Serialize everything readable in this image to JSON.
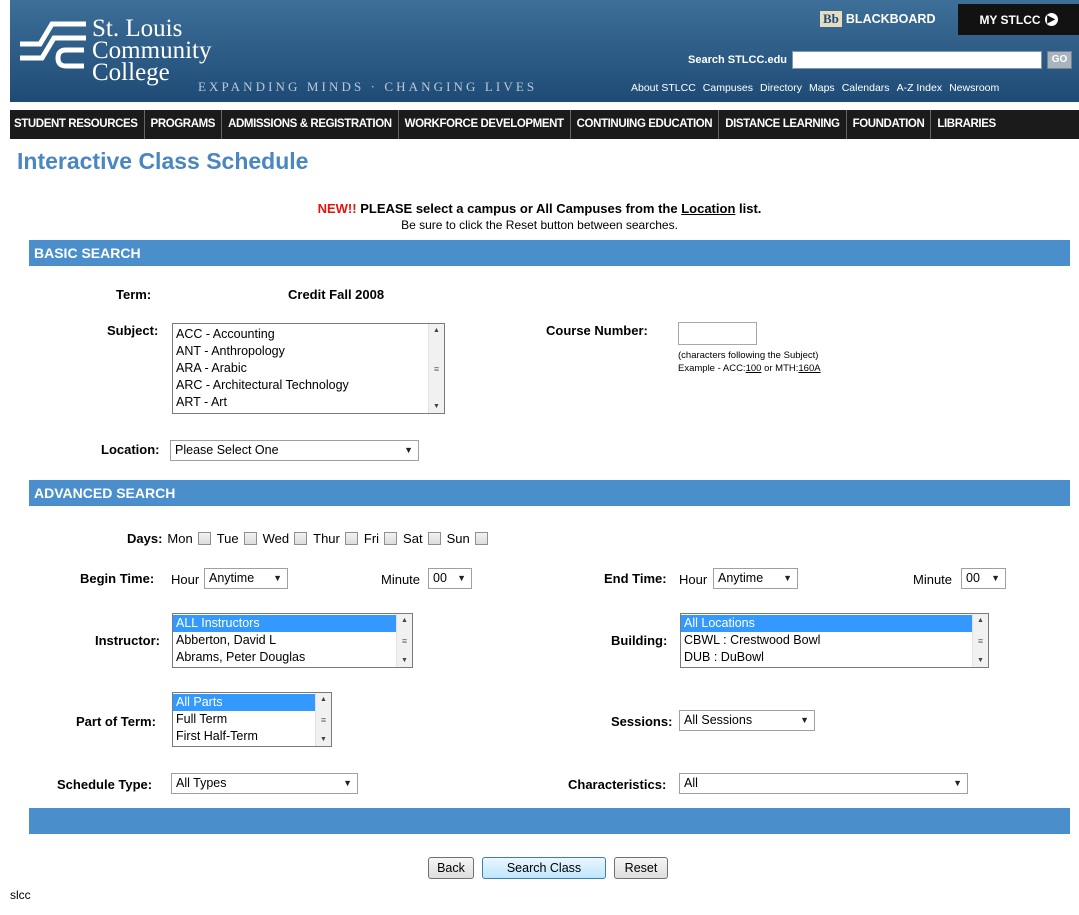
{
  "header": {
    "logo": {
      "line1": "St. Louis",
      "line2": "Community",
      "line3": "College"
    },
    "tagline": "EXPANDING MINDS · CHANGING LIVES",
    "blackboard_badge": "Bb",
    "blackboard_label": "BLACKBOARD",
    "my_stlcc_label": "MY STLCC",
    "search_label": "Search STLCC.edu",
    "search_value": "",
    "go_label": "GO",
    "util_links": [
      "About STLCC",
      "Campuses",
      "Directory",
      "Maps",
      "Calendars",
      "A-Z Index",
      "Newsroom"
    ],
    "brand_color": "#1e4b75"
  },
  "nav": [
    "STUDENT RESOURCES",
    "PROGRAMS",
    "ADMISSIONS & REGISTRATION",
    "WORKFORCE DEVELOPMENT",
    "CONTINUING EDUCATION",
    "DISTANCE LEARNING",
    "FOUNDATION",
    "LIBRARIES"
  ],
  "page": {
    "title": "Interactive Class Schedule",
    "notice_new": "NEW!!",
    "notice_text1": " PLEASE select a campus or All Campuses from the ",
    "notice_link": "Location",
    "notice_text2": " list.",
    "notice_line2": "Be sure to click the Reset button between searches."
  },
  "basic": {
    "header": "BASIC SEARCH",
    "term_label": "Term:",
    "term_value": "Credit Fall 2008",
    "subject_label": "Subject:",
    "subject_options": [
      "ACC - Accounting",
      "ANT - Anthropology",
      "ARA - Arabic",
      "ARC - Architectural Technology",
      "ART - Art"
    ],
    "course_number_label": "Course Number:",
    "course_number_value": "",
    "course_hint": "(characters following the Subject)",
    "example_prefix": "Example - ACC:",
    "example_acc": "100",
    "example_or": " or MTH:",
    "example_mth": "160A",
    "location_label": "Location:",
    "location_value": "Please Select One"
  },
  "advanced": {
    "header": "ADVANCED SEARCH",
    "days_label": "Days:",
    "days": [
      "Mon",
      "Tue",
      "Wed",
      "Thur",
      "Fri",
      "Sat",
      "Sun"
    ],
    "begin_time_label": "Begin Time:",
    "end_time_label": "End Time:",
    "hour_label": "Hour",
    "minute_label": "Minute",
    "begin_hour": "Anytime",
    "begin_minute": "00",
    "end_hour": "Anytime",
    "end_minute": "00",
    "instructor_label": "Instructor:",
    "instructor_options": [
      "ALL Instructors",
      "Abberton, David L",
      "Abrams, Peter Douglas"
    ],
    "building_label": "Building:",
    "building_options": [
      "All Locations",
      "CBWL : Crestwood Bowl",
      "DUB : DuBowl"
    ],
    "part_of_term_label": "Part of Term:",
    "part_of_term_options": [
      "All Parts",
      "Full Term",
      "First Half-Term"
    ],
    "sessions_label": "Sessions:",
    "sessions_value": "All Sessions",
    "schedule_type_label": "Schedule Type:",
    "schedule_type_value": "All Types",
    "characteristics_label": "Characteristics:",
    "characteristics_value": "All"
  },
  "buttons": {
    "back": "Back",
    "search": "Search Class",
    "reset": "Reset"
  },
  "footer": "slcc",
  "colors": {
    "band": "#4a8fcc",
    "title": "#4a86c0",
    "notice_red": "#e8140c",
    "selection": "#3399ff"
  }
}
